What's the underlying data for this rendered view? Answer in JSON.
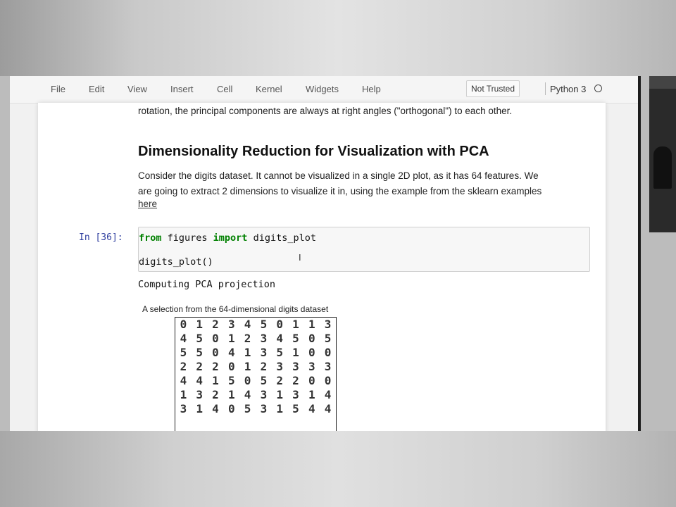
{
  "menubar": {
    "items": [
      "File",
      "Edit",
      "View",
      "Insert",
      "Cell",
      "Kernel",
      "Widgets",
      "Help"
    ],
    "trust_status": "Not Trusted",
    "kernel_name": "Python 3"
  },
  "notebook": {
    "prev_text": "rotation, the principal components are always at right angles (\"orthogonal\") to each other.",
    "heading": "Dimensionality Reduction for Visualization with PCA",
    "para_line1": "Consider the digits dataset. It cannot be visualized in a single 2D plot, as it has 64 features. We",
    "para_line2": "are going to extract 2 dimensions to visualize it in, using the example from the sklearn examples",
    "link_text": "here",
    "cell": {
      "prompt": "In [36]:",
      "code_line1_kw1": "from",
      "code_line1_mod": " figures ",
      "code_line1_kw2": "import",
      "code_line1_name": " digits_plot",
      "code_line2": "digits_plot()",
      "output": "Computing PCA projection",
      "figure_title": "A selection from the 64-dimensional digits dataset",
      "digit_rows": [
        [
          "0",
          "1",
          "2",
          "3",
          "4",
          "5",
          "0",
          "1",
          "1",
          "3"
        ],
        [
          "4",
          "5",
          "0",
          "1",
          "2",
          "3",
          "4",
          "5",
          "0",
          "5"
        ],
        [
          "5",
          "5",
          "0",
          "4",
          "1",
          "3",
          "5",
          "1",
          "0",
          "0"
        ],
        [
          "2",
          "2",
          "2",
          "0",
          "1",
          "2",
          "3",
          "3",
          "3",
          "3"
        ],
        [
          "4",
          "4",
          "1",
          "5",
          "0",
          "5",
          "2",
          "2",
          "0",
          "0"
        ],
        [
          "1",
          "3",
          "2",
          "1",
          "4",
          "3",
          "1",
          "3",
          "1",
          "4"
        ],
        [
          "3",
          "1",
          "4",
          "0",
          "5",
          "3",
          "1",
          "5",
          "4",
          "4"
        ],
        [
          "",
          "",
          "",
          "",
          "",
          "",
          "",
          "",
          "",
          ""
        ]
      ]
    }
  },
  "icons": {
    "kernel_status": "circle-idle-icon",
    "text_cursor": "i-beam-cursor-icon"
  }
}
